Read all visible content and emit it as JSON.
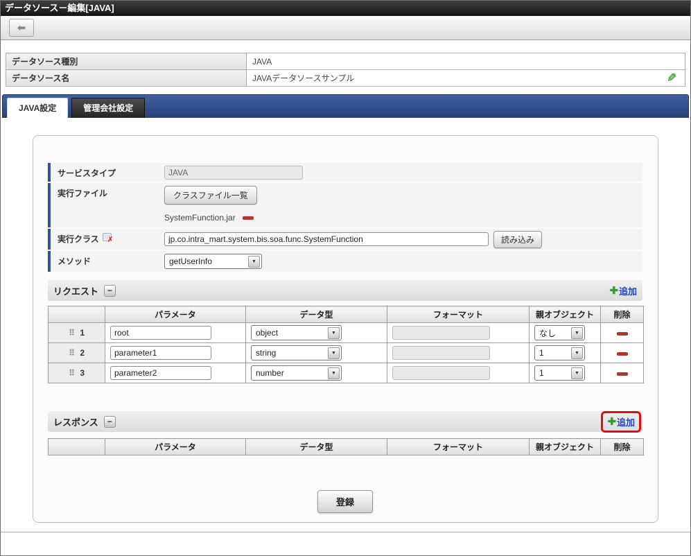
{
  "window": {
    "title": "データソース－編集[JAVA]"
  },
  "icons": {
    "back": "⬅",
    "edit_pencil": "✎",
    "minus_collapse": "−",
    "plus": "✚",
    "dropdown": "▼",
    "drag_handle": "⠿",
    "clear_x": "✗"
  },
  "info": {
    "rows": [
      {
        "label": "データソース種別",
        "value": "JAVA"
      },
      {
        "label": "データソース名",
        "value": "JAVAデータソースサンプル"
      }
    ]
  },
  "tabs": [
    {
      "label": "JAVA設定"
    },
    {
      "label": "管理会社設定"
    }
  ],
  "form": {
    "service_type_label": "サービスタイプ",
    "service_type_value": "JAVA",
    "exec_file_label": "実行ファイル",
    "class_file_button": "クラスファイル一覧",
    "file_name": "SystemFunction.jar",
    "exec_class_label": "実行クラス",
    "exec_class_value": "jp.co.intra_mart.system.bis.soa.func.SystemFunction",
    "load_button": "読み込み",
    "method_label": "メソッド",
    "method_value": "getUserInfo"
  },
  "request": {
    "title": "リクエスト",
    "add_label": "追加",
    "headers": {
      "param": "パラメータ",
      "type": "データ型",
      "format": "フォーマット",
      "parent": "親オブジェクト",
      "delete": "削除"
    },
    "rows": [
      {
        "num": "1",
        "parameter": "root",
        "data_type": "object",
        "format": "",
        "parent": "なし"
      },
      {
        "num": "2",
        "parameter": "parameter1",
        "data_type": "string",
        "format": "",
        "parent": "1"
      },
      {
        "num": "3",
        "parameter": "parameter2",
        "data_type": "number",
        "format": "",
        "parent": "1"
      }
    ]
  },
  "response": {
    "title": "レスポンス",
    "add_label": "追加",
    "headers": {
      "param": "パラメータ",
      "type": "データ型",
      "format": "フォーマット",
      "parent": "親オブジェクト",
      "delete": "削除"
    }
  },
  "actions": {
    "register": "登録"
  },
  "colors": {
    "tab_bar_blue": "#2f4f8e",
    "accent_blue": "#31539b",
    "add_link_blue": "#2244cc",
    "delete_red": "#b3342c",
    "highlight_red": "#e01010",
    "plus_green": "#2f9e2f",
    "pencil_green": "#3aa02f"
  }
}
